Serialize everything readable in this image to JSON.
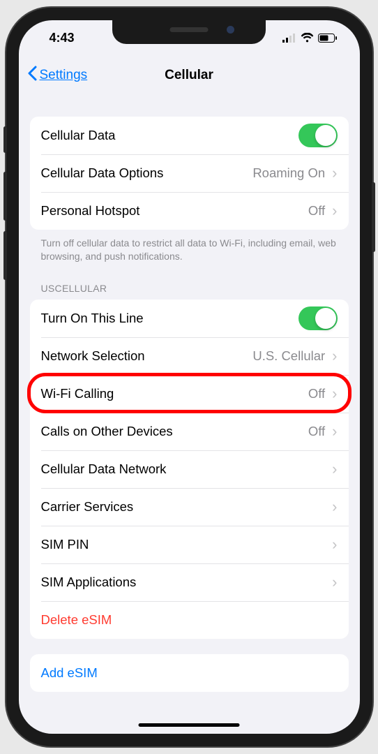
{
  "status": {
    "time": "4:43"
  },
  "nav": {
    "back": "Settings",
    "title": "Cellular"
  },
  "group1": {
    "cellular_data": "Cellular Data",
    "cellular_data_options": "Cellular Data Options",
    "cellular_data_options_value": "Roaming On",
    "personal_hotspot": "Personal Hotspot",
    "personal_hotspot_value": "Off",
    "footer": "Turn off cellular data to restrict all data to Wi-Fi, including email, web browsing, and push notifications."
  },
  "carrier_section": {
    "header": "USCELLULAR"
  },
  "group2": {
    "turn_on_line": "Turn On This Line",
    "network_selection": "Network Selection",
    "network_selection_value": "U.S. Cellular",
    "wifi_calling": "Wi-Fi Calling",
    "wifi_calling_value": "Off",
    "calls_other": "Calls on Other Devices",
    "calls_other_value": "Off",
    "cellular_data_network": "Cellular Data Network",
    "carrier_services": "Carrier Services",
    "sim_pin": "SIM PIN",
    "sim_applications": "SIM Applications",
    "delete_esim": "Delete eSIM"
  },
  "group3": {
    "add_esim": "Add eSIM"
  },
  "highlight": {
    "target": "wifi-calling-row"
  }
}
